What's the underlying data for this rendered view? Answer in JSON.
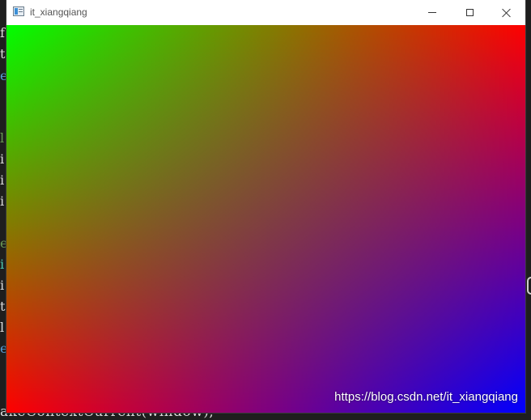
{
  "window": {
    "title": "it_xiangqiang",
    "controls": {
      "minimize": "minimize-icon",
      "maximize": "maximize-icon",
      "close": "close-icon"
    }
  },
  "canvas": {
    "description_colors": {
      "top_left": "#00ff00",
      "top_right": "#ff0000",
      "bottom_left": "#ff0000",
      "bottom_right": "#0000ff"
    }
  },
  "watermark": "https://blog.csdn.net/it_xiangqiang",
  "background_code": {
    "left_chars": [
      {
        "char": "f",
        "color": "#dcdcdc"
      },
      {
        "char": "t",
        "color": "#dcdcdc"
      },
      {
        "char": "e",
        "color": "#569cd6"
      },
      {
        "char": "",
        "color": "#dcdcdc"
      },
      {
        "char": "l",
        "color": "#6a9955"
      },
      {
        "char": "i",
        "color": "#dcdcdc"
      },
      {
        "char": "i",
        "color": "#dcdcdc"
      },
      {
        "char": "i",
        "color": "#dcdcdc"
      },
      {
        "char": "",
        "color": "#dcdcdc"
      },
      {
        "char": "e",
        "color": "#6a9955"
      },
      {
        "char": "i",
        "color": "#4ec9b0"
      },
      {
        "char": "i",
        "color": "#dcdcdc"
      },
      {
        "char": "t",
        "color": "#dcdcdc"
      },
      {
        "char": "l",
        "color": "#dcdcdc"
      },
      {
        "char": "e",
        "color": "#569cd6"
      }
    ],
    "bottom_line": "akeContextCurrent(window);"
  }
}
